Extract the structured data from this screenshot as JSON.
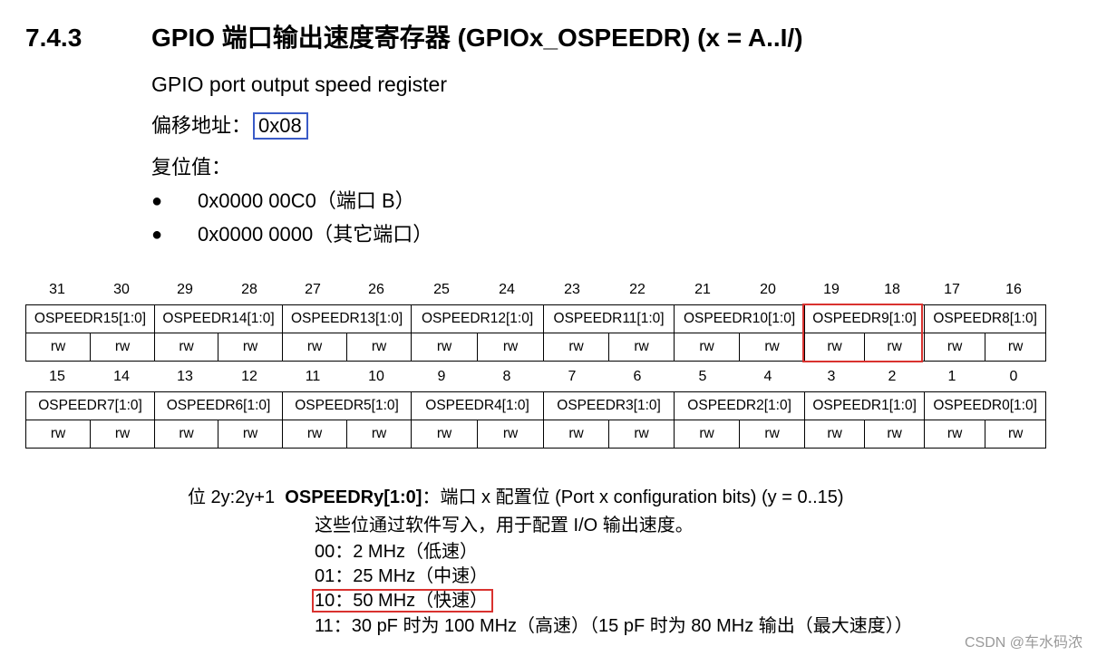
{
  "section": {
    "number": "7.4.3",
    "title": "GPIO 端口输出速度寄存器 (GPIOx_OSPEEDR) (x = A..I/)",
    "subtitle": "GPIO port output speed register",
    "offset_label": "偏移地址：",
    "offset_value": "0x08",
    "reset_label": "复位值：",
    "reset_values": [
      {
        "bullet": "●",
        "text": "0x0000 00C0（端口 B）"
      },
      {
        "bullet": "●",
        "text": "0x0000 0000（其它端口）"
      }
    ]
  },
  "register": {
    "upper_bits": [
      "31",
      "30",
      "29",
      "28",
      "27",
      "26",
      "25",
      "24",
      "23",
      "22",
      "21",
      "20",
      "19",
      "18",
      "17",
      "16"
    ],
    "upper_fields": [
      "OSPEEDR15[1:0]",
      "OSPEEDR14[1:0]",
      "OSPEEDR13[1:0]",
      "OSPEEDR12[1:0]",
      "OSPEEDR11[1:0]",
      "OSPEEDR10[1:0]",
      "OSPEEDR9[1:0]",
      "OSPEEDR8[1:0]"
    ],
    "upper_access": [
      "rw",
      "rw",
      "rw",
      "rw",
      "rw",
      "rw",
      "rw",
      "rw",
      "rw",
      "rw",
      "rw",
      "rw",
      "rw",
      "rw",
      "rw",
      "rw"
    ],
    "lower_bits": [
      "15",
      "14",
      "13",
      "12",
      "11",
      "10",
      "9",
      "8",
      "7",
      "6",
      "5",
      "4",
      "3",
      "2",
      "1",
      "0"
    ],
    "lower_fields": [
      "OSPEEDR7[1:0]",
      "OSPEEDR6[1:0]",
      "OSPEEDR5[1:0]",
      "OSPEEDR4[1:0]",
      "OSPEEDR3[1:0]",
      "OSPEEDR2[1:0]",
      "OSPEEDR1[1:0]",
      "OSPEEDR0[1:0]"
    ],
    "lower_access": [
      "rw",
      "rw",
      "rw",
      "rw",
      "rw",
      "rw",
      "rw",
      "rw",
      "rw",
      "rw",
      "rw",
      "rw",
      "rw",
      "rw",
      "rw",
      "rw"
    ]
  },
  "description": {
    "bits": "位 2y:2y+1",
    "field": "OSPEEDRy[1:0]",
    "summary": "：端口 x 配置位 (Port x configuration bits) (y = 0..15)",
    "intro": "这些位通过软件写入，用于配置 I/O 输出速度。",
    "options": [
      "00：2 MHz（低速）",
      "01：25 MHz（中速）",
      "10：50 MHz（快速）",
      "11：30 pF 时为 100 MHz（高速）（15 pF 时为 80 MHz 输出（最大速度））"
    ]
  },
  "watermark": "CSDN @车水码浓",
  "colors": {
    "offset_highlight": "#3a5bc7",
    "red_highlight": "#d9322f"
  }
}
